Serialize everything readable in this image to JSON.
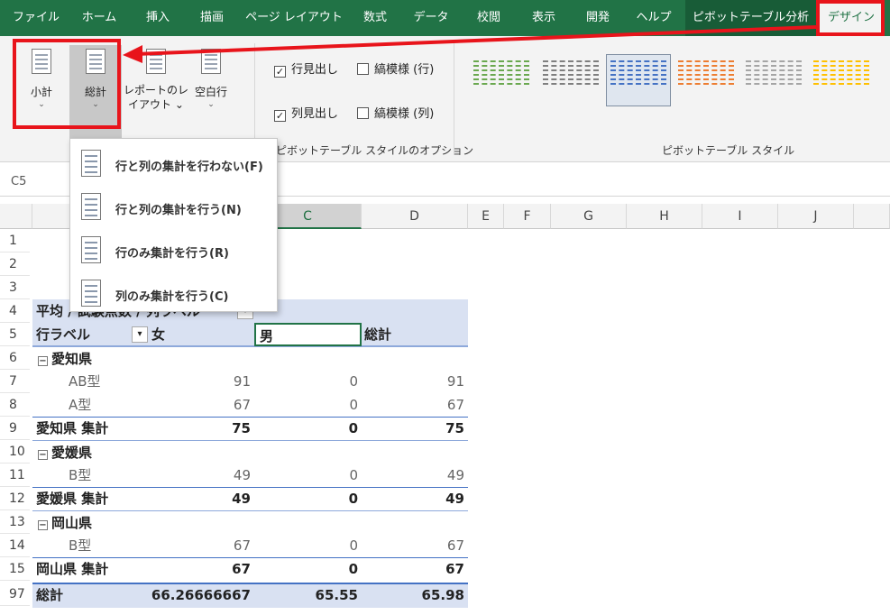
{
  "tabs": [
    "ファイル",
    "ホーム",
    "挿入",
    "描画",
    "ページ レイアウト",
    "数式",
    "データ",
    "校閲",
    "表示",
    "開発",
    "ヘルプ",
    "ピボットテーブル分析",
    "デザイン"
  ],
  "ribbon": {
    "subtotal_label": "小計",
    "grandtotal_label": "総計",
    "report_layout_label_1": "レポートのレ",
    "report_layout_label_2": "イアウト",
    "blank_rows_label": "空白行",
    "opt_row_headers": "行見出し",
    "opt_banded_rows": "縞模様 (行)",
    "opt_col_headers": "列見出し",
    "opt_banded_cols": "縞模様 (列)",
    "group_options_label": "ピボットテーブル スタイルのオプション",
    "group_styles_label": "ピボットテーブル スタイル",
    "style_colors": [
      "#6aa84f",
      "#7f7f7f",
      "#4472c4",
      "#ed7d31",
      "#a5a5a5",
      "#ffc000"
    ]
  },
  "namebox": "C5",
  "columns": [
    "C",
    "D",
    "E",
    "F",
    "G",
    "H",
    "I",
    "J"
  ],
  "rows": [
    "1",
    "2",
    "3",
    "4",
    "5",
    "6",
    "7",
    "8",
    "9",
    "10",
    "11",
    "12",
    "13",
    "14",
    "15",
    "97"
  ],
  "menu": {
    "item_none": "行と列の集計を行わない(F)",
    "item_both": "行と列の集計を行う(N)",
    "item_rows": "行のみ集計を行う(R)",
    "item_cols": "列のみ集計を行う(C)"
  },
  "pivot": {
    "title_cell": "平均 / 試験点数",
    "title_tail": "列ラベル",
    "row_label_header": "行ラベル",
    "col_female": "女",
    "col_male": "男",
    "col_total": "総計",
    "groups": [
      {
        "name": "愛知県",
        "items": [
          {
            "label": "AB型",
            "f": "91",
            "m": "0",
            "t": "91"
          },
          {
            "label": "A型",
            "f": "67",
            "m": "0",
            "t": "67"
          }
        ],
        "subtotal_label": "愛知県 集計",
        "sf": "75",
        "sm": "0",
        "st": "75"
      },
      {
        "name": "愛媛県",
        "items": [
          {
            "label": "B型",
            "f": "49",
            "m": "0",
            "t": "49"
          }
        ],
        "subtotal_label": "愛媛県 集計",
        "sf": "49",
        "sm": "0",
        "st": "49"
      },
      {
        "name": "岡山県",
        "items": [
          {
            "label": "B型",
            "f": "67",
            "m": "0",
            "t": "67"
          }
        ],
        "subtotal_label": "岡山県 集計",
        "sf": "67",
        "sm": "0",
        "st": "67"
      }
    ],
    "grand_label": "総計",
    "grand_f": "66.26666667",
    "grand_m": "65.55",
    "grand_t": "65.98"
  }
}
